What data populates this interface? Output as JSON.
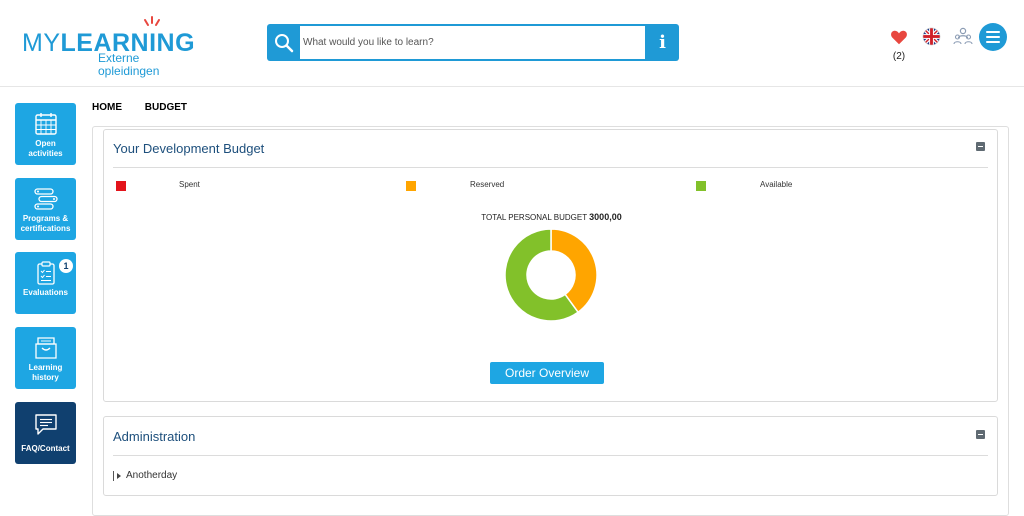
{
  "header": {
    "logo_main_prefix": "MY",
    "logo_main_bold": "LEARNING",
    "logo_sub": "Externe opleidingen",
    "search_placeholder": "What would you like to learn?",
    "info_label": "i",
    "favorites_count": "(2)",
    "colors": {
      "brand": "#1f9ad6",
      "heart": "#e8473f",
      "spark": "#e8473f"
    },
    "icons": [
      "search-icon",
      "info-icon",
      "heart-icon",
      "uk-flag-icon",
      "users-icon",
      "hamburger-menu-icon"
    ]
  },
  "sidebar": {
    "items": [
      {
        "label": "Open\nactivities",
        "icon": "calendar-icon"
      },
      {
        "label": "Programs &\ncertifications",
        "icon": "roadmap-icon"
      },
      {
        "label": "Evaluations",
        "icon": "clipboard-icon",
        "badge": "1"
      },
      {
        "label": "Learning\nhistory",
        "icon": "archive-box-icon"
      },
      {
        "label": "FAQ/Contact",
        "icon": "chat-icon"
      }
    ],
    "colors": {
      "tile": "#1ea6e3",
      "tile_dark": "#10406f"
    }
  },
  "breadcrumb": {
    "home": "HOME",
    "current": "BUDGET"
  },
  "budget_panel": {
    "title": "Your Development Budget",
    "legend": [
      {
        "label": "Spent",
        "color": "#e3141b"
      },
      {
        "label": "Reserved",
        "color": "#ffa500"
      },
      {
        "label": "Available",
        "color": "#82c12a"
      }
    ],
    "total_label": "TOTAL PERSONAL BUDGET",
    "total_value": "3000,00",
    "order_button": "Order Overview"
  },
  "chart_data": {
    "type": "pie",
    "categories": [
      "Spent",
      "Reserved",
      "Available"
    ],
    "values": [
      0,
      40,
      60
    ],
    "colors": [
      "#e3141b",
      "#ffa500",
      "#82c12a"
    ],
    "donut": true
  },
  "admin_panel": {
    "title": "Administration",
    "items": [
      "Anotherday"
    ]
  }
}
